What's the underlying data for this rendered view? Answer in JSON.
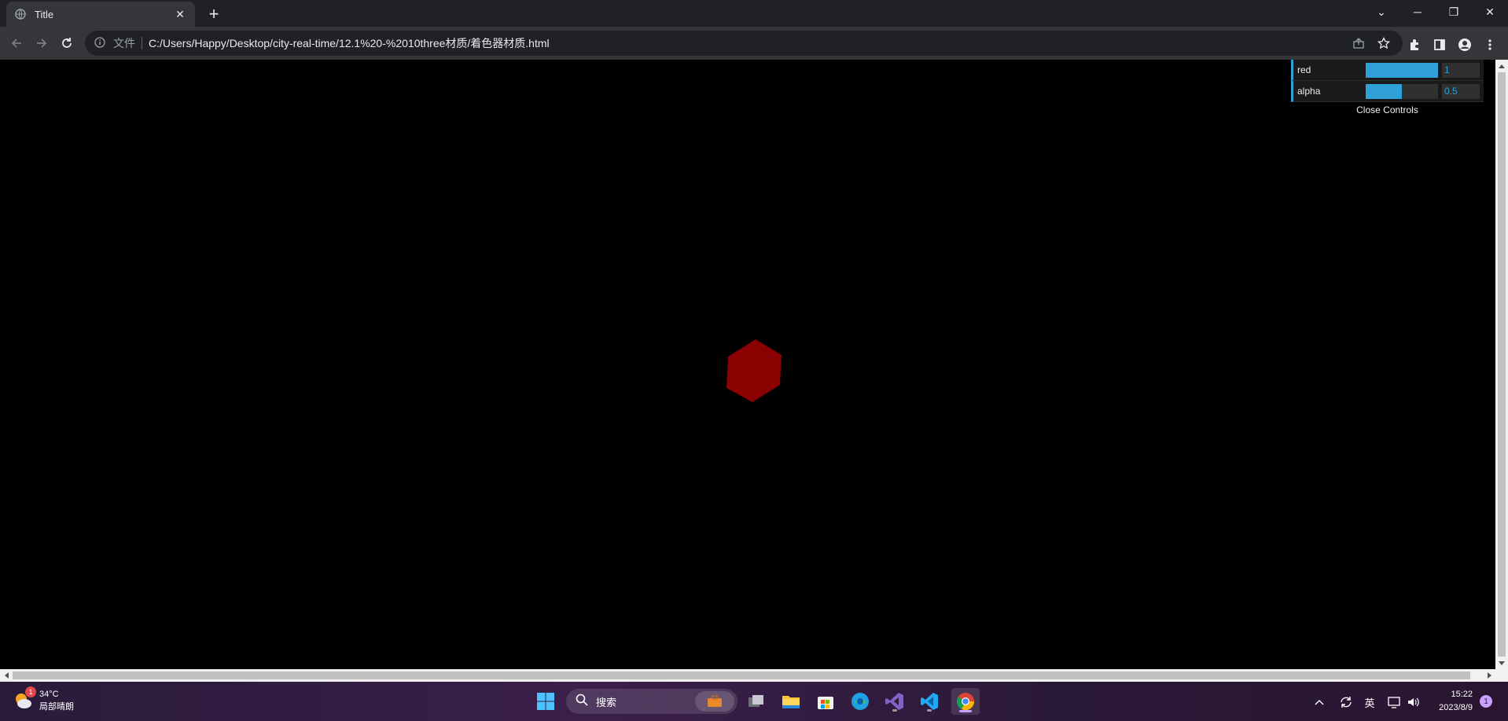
{
  "browser": {
    "tab_title": "Title",
    "scheme_label": "文件",
    "url": "C:/Users/Happy/Desktop/city-real-time/12.1%20-%2010three材质/着色器材质.html"
  },
  "gui": {
    "controls": [
      {
        "name": "red",
        "value": "1",
        "fraction": 1.0
      },
      {
        "name": "alpha",
        "value": "0.5",
        "fraction": 0.5
      }
    ],
    "close_label": "Close Controls"
  },
  "scene": {
    "object": "hexagon-cube",
    "object_color": "#8b0000"
  },
  "taskbar": {
    "weather_temp": "34°C",
    "weather_desc": "局部晴朗",
    "weather_badge": "1",
    "search_label": "搜索",
    "ime_label": "英",
    "time": "15:22",
    "date": "2023/8/9",
    "notification_count": "1"
  },
  "colors": {
    "accent": "#2fa1d6",
    "browser_bg": "#202124",
    "toolbar_bg": "#35363a"
  }
}
